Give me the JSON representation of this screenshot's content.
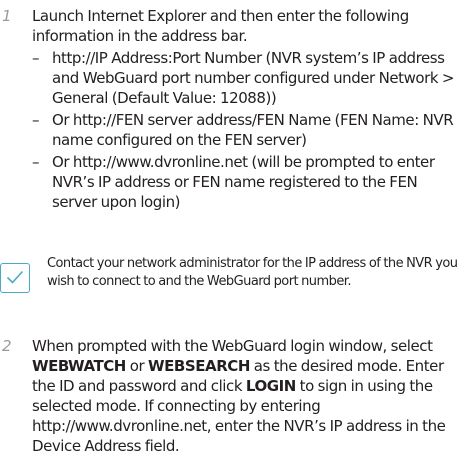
{
  "step1": {
    "number": "1",
    "intro": "Launch Internet Explorer and then enter the following information in the address bar.",
    "bullets": [
      "http://IP Address:Port Number (NVR system’s IP address and WebGuard port number configured under Network > General (Default Value: 12088))",
      "Or http://FEN server address/FEN Name (FEN Name: NVR name configured on the FEN server)",
      "Or http://www.dvronline.net (will be prompted to enter NVR’s IP address or FEN name registered to the FEN server upon login)"
    ],
    "dash": "–"
  },
  "note": {
    "icon": "checkmark-icon",
    "accent_color": "#4aa8c9",
    "text": "Contact your network administrator for the IP address of the NVR you wish to connect to and the WebGuard port number."
  },
  "step2": {
    "number": "2",
    "t1": "When prompted with the WebGuard login window, select ",
    "b1": "WEBWATCH",
    "t2": " or ",
    "b2": "WEBSEARCH",
    "t3": " as the desired mode. Enter the ID and password and click ",
    "b3": "LOGIN",
    "t4": " to sign in using the selected mode. If connecting by entering http://www.dvronline.net, enter the NVR’s IP address in the Device Address field."
  }
}
